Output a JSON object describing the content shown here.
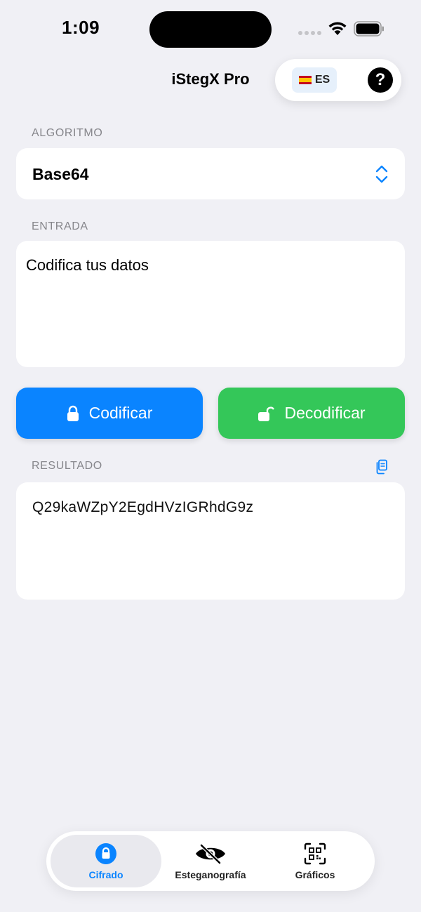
{
  "status_bar": {
    "time": "1:09"
  },
  "header": {
    "title": "iStegX Pro",
    "language_code": "ES",
    "help_label": "?"
  },
  "algorithm": {
    "label": "ALGORITMO",
    "value": "Base64"
  },
  "input": {
    "label": "ENTRADA",
    "value": "Codifica tus datos"
  },
  "actions": {
    "encode_label": "Codificar",
    "decode_label": "Decodificar"
  },
  "result": {
    "label": "RESULTADO",
    "value": "Q29kaWZpY2EgdHVzIGRhdG9z"
  },
  "tabs": [
    {
      "label": "Cifrado",
      "icon": "lock-circle-icon",
      "selected": true
    },
    {
      "label": "Esteganografía",
      "icon": "eye-slash-icon",
      "selected": false
    },
    {
      "label": "Gráficos",
      "icon": "qr-code-icon",
      "selected": false
    }
  ],
  "colors": {
    "accent": "#0a84ff",
    "encode": "#0a84ff",
    "decode": "#34c759",
    "background": "#f0f0f5"
  }
}
